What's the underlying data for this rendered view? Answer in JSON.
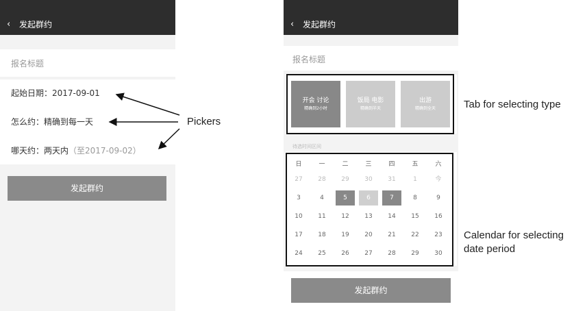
{
  "colors": {
    "header_bg": "#2d2d2d",
    "button_bg": "#8a8a8a",
    "tab_active": "#888888",
    "tab_inactive": "#cccccc",
    "range_end": "#888888",
    "range_mid": "#cfcfcf"
  },
  "left_screen": {
    "header": {
      "back_icon": "‹",
      "title": "发起群约"
    },
    "title_placeholder": "报名标题",
    "rows": {
      "start_date": "起始日期：2017-09-01",
      "how": "怎么约：精确到每一天",
      "which_day_prefix": "哪天约：两天内",
      "which_day_suffix": "（至2017-09-02）"
    },
    "submit": "发起群约"
  },
  "right_screen": {
    "header": {
      "back_icon": "‹",
      "title": "发起群约"
    },
    "title_placeholder": "报名标题",
    "tabs": [
      {
        "label": "开会 讨论",
        "sub": "精确到2小时",
        "state": "active"
      },
      {
        "label": "饭局 电影",
        "sub": "精确到半天",
        "state": "inactive"
      },
      {
        "label": "出游",
        "sub": "精确到全天",
        "state": "inactive"
      }
    ],
    "range_hint": "待选时间区间",
    "calendar": {
      "weekdays": [
        "日",
        "一",
        "二",
        "三",
        "四",
        "五",
        "六"
      ],
      "weeks": [
        [
          {
            "d": "27",
            "s": "dim"
          },
          {
            "d": "28",
            "s": "dim"
          },
          {
            "d": "29",
            "s": "dim"
          },
          {
            "d": "30",
            "s": "dim"
          },
          {
            "d": "31",
            "s": "dim"
          },
          {
            "d": "1",
            "s": "dim"
          },
          {
            "d": "今",
            "s": "dim"
          }
        ],
        [
          {
            "d": "3",
            "s": ""
          },
          {
            "d": "4",
            "s": ""
          },
          {
            "d": "5",
            "s": "dark"
          },
          {
            "d": "6",
            "s": "light"
          },
          {
            "d": "7",
            "s": "dark"
          },
          {
            "d": "8",
            "s": ""
          },
          {
            "d": "9",
            "s": ""
          }
        ],
        [
          {
            "d": "10",
            "s": ""
          },
          {
            "d": "11",
            "s": ""
          },
          {
            "d": "12",
            "s": ""
          },
          {
            "d": "13",
            "s": ""
          },
          {
            "d": "14",
            "s": ""
          },
          {
            "d": "15",
            "s": ""
          },
          {
            "d": "16",
            "s": ""
          }
        ],
        [
          {
            "d": "17",
            "s": ""
          },
          {
            "d": "18",
            "s": ""
          },
          {
            "d": "19",
            "s": ""
          },
          {
            "d": "20",
            "s": ""
          },
          {
            "d": "21",
            "s": ""
          },
          {
            "d": "22",
            "s": ""
          },
          {
            "d": "23",
            "s": ""
          }
        ],
        [
          {
            "d": "24",
            "s": ""
          },
          {
            "d": "25",
            "s": ""
          },
          {
            "d": "26",
            "s": ""
          },
          {
            "d": "27",
            "s": ""
          },
          {
            "d": "28",
            "s": ""
          },
          {
            "d": "29",
            "s": ""
          },
          {
            "d": "30",
            "s": ""
          }
        ]
      ]
    },
    "submit": "发起群约"
  },
  "annotations": {
    "pickers": "Pickers",
    "tab_note": "Tab for selecting type",
    "calendar_note_line1": "Calendar for selecting",
    "calendar_note_line2": "date period"
  }
}
